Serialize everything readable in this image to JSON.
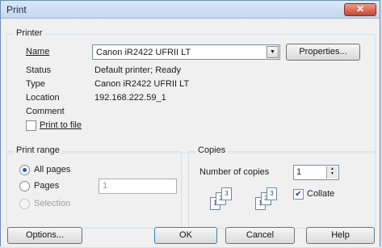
{
  "window": {
    "title": "Print",
    "close_glyph": "✕"
  },
  "printer": {
    "legend": "Printer",
    "name_label": "Name",
    "name_value": "Canon iR2422 UFRII LT",
    "properties_button": "Properties...",
    "status_label": "Status",
    "status_value": "Default printer; Ready",
    "type_label": "Type",
    "type_value": "Canon iR2422 UFRII LT",
    "location_label": "Location",
    "location_value": "192.168.222.59_1",
    "comment_label": "Comment",
    "print_to_file_label": "Print to file",
    "print_to_file_checked": false
  },
  "print_range": {
    "legend": "Print range",
    "all_pages_label": "All pages",
    "pages_label": "Pages",
    "pages_value": "1",
    "selection_label": "Selection",
    "selected": "all"
  },
  "copies": {
    "legend": "Copies",
    "number_label": "Number of copies",
    "number_value": "1",
    "collate_label": "Collate",
    "collate_checked": true,
    "collate_glyph": "✔",
    "page_numbers": [
      "1",
      "2",
      "3"
    ]
  },
  "footer": {
    "options_button": "Options...",
    "ok_button": "OK",
    "cancel_button": "Cancel",
    "help_button": "Help"
  },
  "colors": {
    "titlebar": "#c4d8ee",
    "close": "#c6462f",
    "client": "#f0f0f0"
  },
  "icons": [
    "close-icon",
    "chevron-down-icon",
    "spin-arrows-icon",
    "collate-pages-icon"
  ]
}
